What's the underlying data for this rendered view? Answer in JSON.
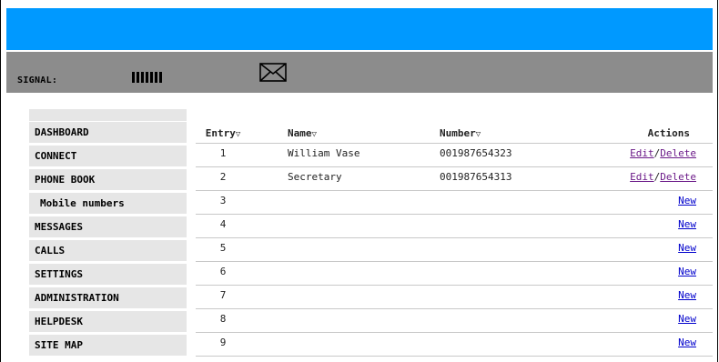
{
  "header": {
    "signal_label": "SIGNAL:",
    "signal_bars": 7,
    "message_icon": "envelope-icon",
    "colors": {
      "topbar": "#0099ff",
      "statusbar": "#8c8c8c",
      "sidebar": "#e6e6e6"
    }
  },
  "sidebar": {
    "items": [
      {
        "label": "DASHBOARD"
      },
      {
        "label": "CONNECT"
      },
      {
        "label": "PHONE BOOK"
      },
      {
        "label": "Mobile numbers"
      },
      {
        "label": "MESSAGES"
      },
      {
        "label": "CALLS"
      },
      {
        "label": "SETTINGS"
      },
      {
        "label": "ADMINISTRATION"
      },
      {
        "label": "HELPDESK"
      },
      {
        "label": "SITE MAP"
      }
    ]
  },
  "table": {
    "headers": {
      "entry": "Entry",
      "name": "Name",
      "number": "Number",
      "actions": "Actions",
      "sort_glyph": "▽"
    },
    "rows": [
      {
        "entry": "1",
        "name": "William Vase",
        "number": "001987654323",
        "edit": "Edit",
        "sep": "/",
        "delete": "Delete"
      },
      {
        "entry": "2",
        "name": "Secretary",
        "number": "001987654313",
        "edit": "Edit",
        "sep": "/",
        "delete": "Delete"
      },
      {
        "entry": "3",
        "new": "New"
      },
      {
        "entry": "4",
        "new": "New"
      },
      {
        "entry": "5",
        "new": "New"
      },
      {
        "entry": "6",
        "new": "New"
      },
      {
        "entry": "7",
        "new": "New"
      },
      {
        "entry": "8",
        "new": "New"
      },
      {
        "entry": "9",
        "new": "New"
      }
    ]
  }
}
